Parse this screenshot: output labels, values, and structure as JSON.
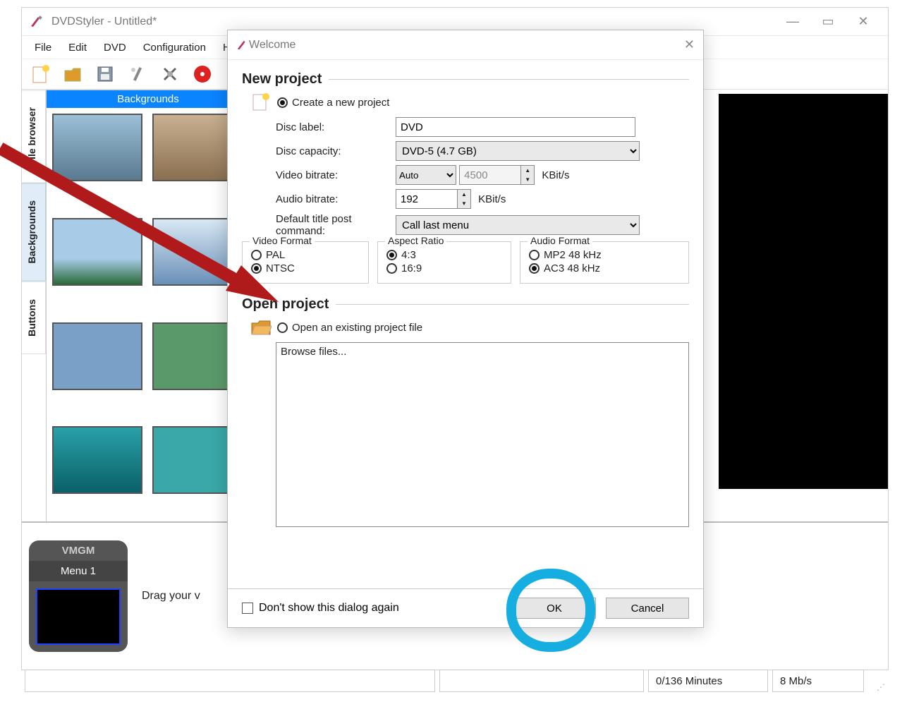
{
  "main": {
    "title": "DVDStyler - Untitled*",
    "menu": {
      "file": "File",
      "edit": "Edit",
      "dvd": "DVD",
      "config": "Configuration",
      "help": "H"
    },
    "sidetabs": {
      "filebrowser": "File browser",
      "backgrounds": "Backgrounds",
      "buttons": "Buttons"
    },
    "gallery_header": "Backgrounds",
    "vmgm": {
      "title": "VMGM",
      "menu": "Menu 1"
    },
    "drag_hint": "Drag your v",
    "status": {
      "minutes": "0/136 Minutes",
      "rate": "8 Mb/s"
    }
  },
  "dlg": {
    "title": "Welcome",
    "new_project_hd": "New project",
    "create_label": "Create a new project",
    "disc_label_lbl": "Disc label:",
    "disc_label_val": "DVD",
    "disc_cap_lbl": "Disc capacity:",
    "disc_cap_val": "DVD-5 (4.7 GB)",
    "vid_br_lbl": "Video bitrate:",
    "vid_br_mode": "Auto",
    "vid_br_val": "4500",
    "vid_br_unit": "KBit/s",
    "aud_br_lbl": "Audio bitrate:",
    "aud_br_val": "192",
    "aud_br_unit": "KBit/s",
    "post_cmd_lbl": "Default title post command:",
    "post_cmd_val": "Call last menu",
    "grp_video": "Video Format",
    "pal": "PAL",
    "ntsc": "NTSC",
    "grp_aspect": "Aspect Ratio",
    "ar43": "4:3",
    "ar169": "16:9",
    "grp_audio": "Audio Format",
    "mp2": "MP2 48 kHz",
    "ac3": "AC3 48 kHz",
    "open_project_hd": "Open project",
    "open_existing": "Open an existing project file",
    "browse": "Browse files...",
    "dont_show": "Don't show this dialog again",
    "ok": "OK",
    "cancel": "Cancel"
  }
}
